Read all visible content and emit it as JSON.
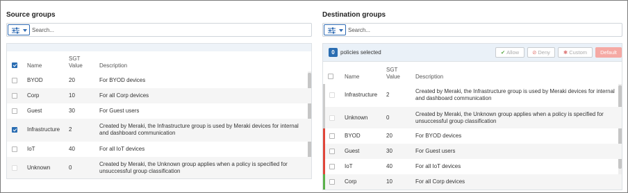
{
  "source": {
    "title": "Source groups",
    "search_placeholder": "Search...",
    "columns": {
      "name": "Name",
      "sgt_line1": "SGT",
      "sgt_line2": "Value",
      "description": "Description"
    },
    "header_checked": true,
    "rows": [
      {
        "name": "BYOD",
        "sgt": "20",
        "desc": "For BYOD devices",
        "checked": false
      },
      {
        "name": "Corp",
        "sgt": "10",
        "desc": "For all Corp devices",
        "checked": false
      },
      {
        "name": "Guest",
        "sgt": "30",
        "desc": "For Guest users",
        "checked": false
      },
      {
        "name": "Infrastructure",
        "sgt": "2",
        "desc": "Created by Meraki, the Infrastructure group is used by Meraki devices for internal and dashboard communication",
        "checked": true
      },
      {
        "name": "IoT",
        "sgt": "40",
        "desc": "For all IoT devices",
        "checked": false
      },
      {
        "name": "Unknown",
        "sgt": "0",
        "desc": "Created by Meraki, the Unknown group applies when a policy is specified for unsuccessful group classification",
        "checked": false
      }
    ]
  },
  "destination": {
    "title": "Destination groups",
    "search_placeholder": "Search...",
    "policies_count": "0",
    "policies_label": "policies selected",
    "buttons": {
      "allow": "Allow",
      "deny": "Deny",
      "custom": "Custom",
      "default": "Default"
    },
    "columns": {
      "name": "Name",
      "sgt_line1": "SGT",
      "sgt_line2": "Value",
      "description": "Description"
    },
    "rows": [
      {
        "name": "Infrastructure",
        "sgt": "2",
        "desc": "Created by Meraki, the Infrastructure group is used by Meraki devices for internal and dashboard communication",
        "accent": "#cccccc"
      },
      {
        "name": "Unknown",
        "sgt": "0",
        "desc": "Created by Meraki, the Unknown group applies when a policy is specified for unsuccessful group classification",
        "accent": "#cccccc"
      },
      {
        "name": "BYOD",
        "sgt": "20",
        "desc": "For BYOD devices",
        "accent": "#e0463a"
      },
      {
        "name": "Guest",
        "sgt": "30",
        "desc": "For Guest users",
        "accent": "#e0463a"
      },
      {
        "name": "IoT",
        "sgt": "40",
        "desc": "For all IoT devices",
        "accent": "#e0463a"
      },
      {
        "name": "Corp",
        "sgt": "10",
        "desc": "For all Corp devices",
        "accent": "#5bb04a"
      }
    ]
  }
}
